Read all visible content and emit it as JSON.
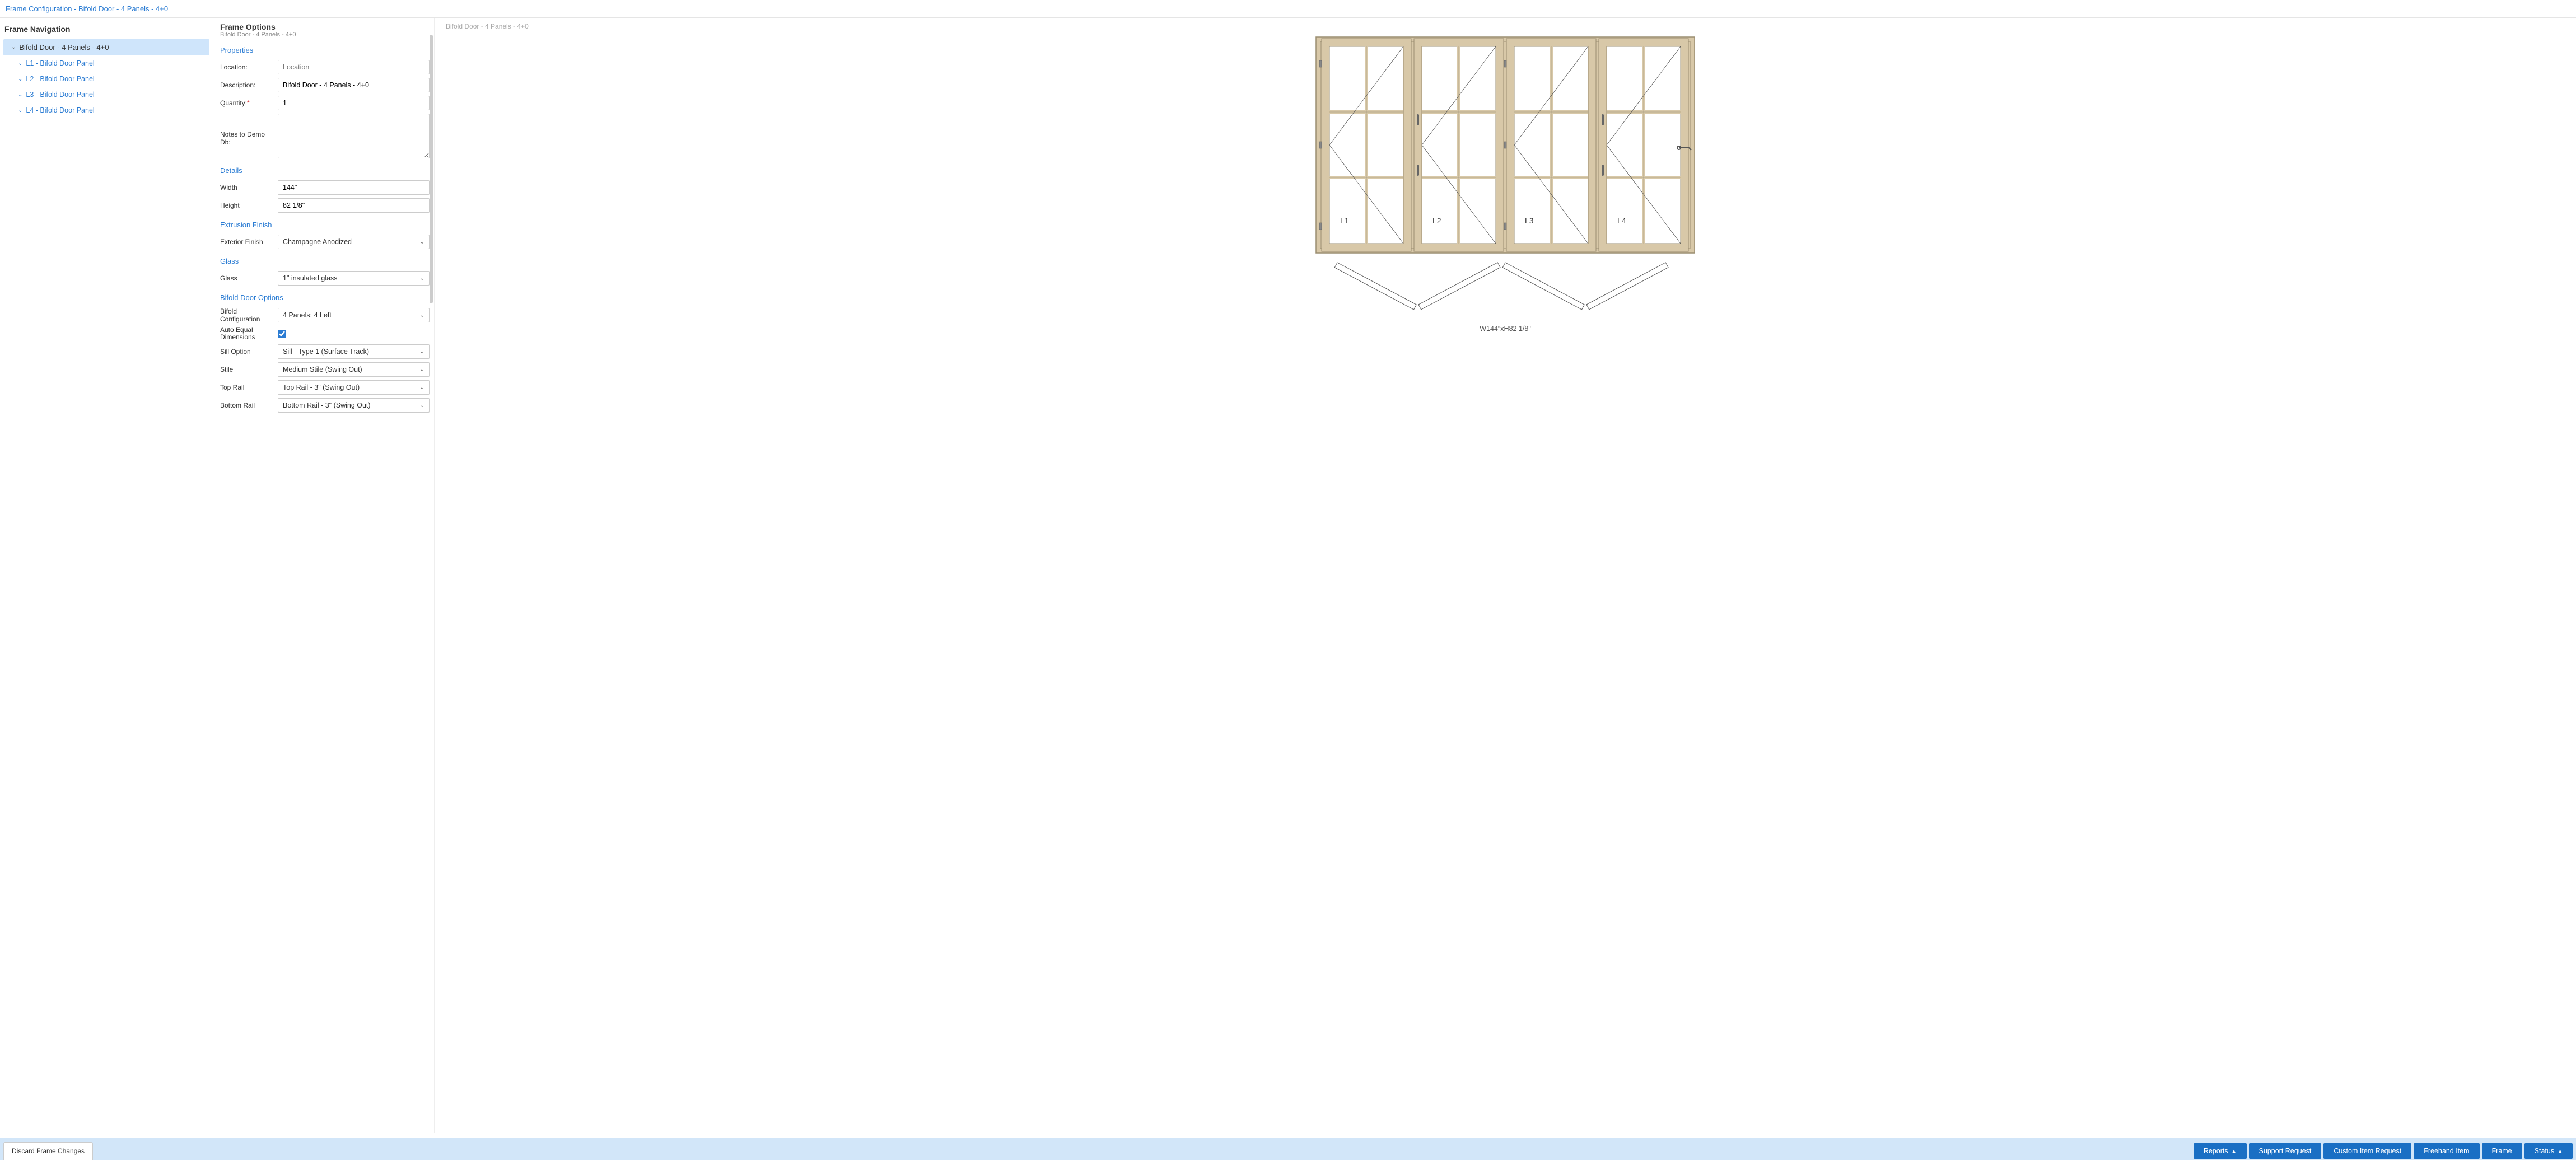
{
  "header": {
    "title": "Frame Configuration - Bifold Door - 4 Panels - 4+0"
  },
  "nav": {
    "title": "Frame Navigation",
    "root": "Bifold Door - 4 Panels - 4+0",
    "items": [
      "L1 - Bifold Door Panel",
      "L2 - Bifold Door Panel",
      "L3 - Bifold Door Panel",
      "L4 - Bifold Door Panel"
    ]
  },
  "form": {
    "title": "Frame Options",
    "subtitle": "Bifold Door - 4 Panels - 4+0",
    "sections": {
      "properties": "Properties",
      "details": "Details",
      "extrusion": "Extrusion Finish",
      "glass": "Glass",
      "bifold": "Bifold Door Options"
    },
    "labels": {
      "location": "Location:",
      "description": "Description:",
      "quantity": "Quantity:",
      "notes": "Notes to Demo Db:",
      "width": "Width",
      "height": "Height",
      "exterior_finish": "Exterior Finish",
      "glass": "Glass",
      "bifold_config": "Bifold Configuration",
      "auto_equal": "Auto Equal Dimensions",
      "sill": "Sill Option",
      "stile": "Stile",
      "top_rail": "Top Rail",
      "bottom_rail": "Bottom Rail"
    },
    "values": {
      "location_placeholder": "Location",
      "description": "Bifold Door - 4 Panels - 4+0",
      "quantity": "1",
      "notes": "",
      "width": "144\"",
      "height": "82 1/8\"",
      "exterior_finish": "Champagne Anodized",
      "glass": "1\" insulated glass",
      "bifold_config": "4 Panels: 4 Left",
      "auto_equal": true,
      "sill": "Sill - Type 1 (Surface Track)",
      "stile": "Medium Stile (Swing Out)",
      "top_rail": "Top Rail - 3\" (Swing Out)",
      "bottom_rail": "Bottom Rail - 3\" (Swing Out)"
    }
  },
  "preview": {
    "subtitle": "Bifold Door - 4 Panels - 4+0",
    "panel_labels": [
      "L1",
      "L2",
      "L3",
      "L4"
    ],
    "dimensions": "W144\"xH82 1/8\""
  },
  "footer": {
    "discard": "Discard Frame Changes",
    "buttons": [
      "Reports",
      "Support Request",
      "Custom Item Request",
      "Freehand Item",
      "Frame",
      "Status"
    ],
    "has_caret": {
      "Reports": true,
      "Status": true
    }
  },
  "colors": {
    "frame": "#d8c8a8",
    "frame_stroke": "#9a8d70",
    "link": "#2b7cd3",
    "btn": "#1a6fc4"
  }
}
